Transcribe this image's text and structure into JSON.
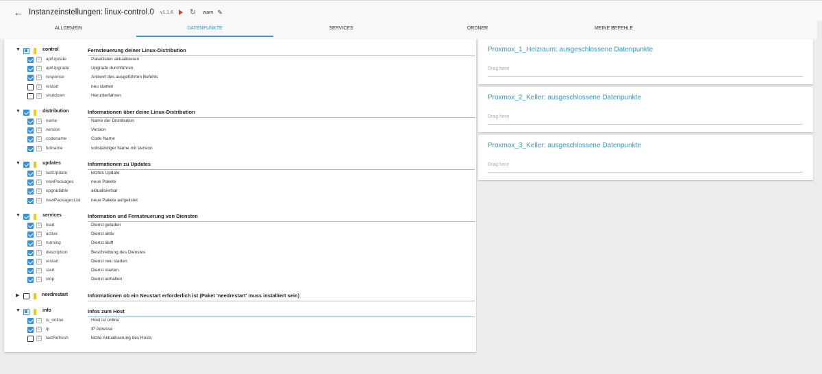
{
  "header": {
    "title": "Instanzeinstellungen: linux-control.0",
    "version": "v1.1.6",
    "loglevel": "warn",
    "accent_color": "#3399cc",
    "run_color": "#e53935"
  },
  "tabs": [
    {
      "label": "ALLGEMEIN",
      "active": false
    },
    {
      "label": "DATENPUNKTE",
      "active": true
    },
    {
      "label": "SERVICES",
      "active": false
    },
    {
      "label": "ORDNER",
      "active": false
    },
    {
      "label": "MEINE BEFEHLE",
      "active": false
    }
  ],
  "tree": [
    {
      "folder": "control",
      "desc": "Fernsteuerung deiner Linux-Distribution",
      "state": "partial",
      "expanded": true,
      "items": [
        {
          "name": "aptUpdate",
          "desc": "Paketlisten aktualisieren",
          "checked": true
        },
        {
          "name": "aptUpgrade",
          "desc": "Upgrade durchführen",
          "checked": true
        },
        {
          "name": "response",
          "desc": "Antwort des ausgeführten Befehls",
          "checked": true
        },
        {
          "name": "restart",
          "desc": "neu starten",
          "checked": false
        },
        {
          "name": "shutdown",
          "desc": "Herunterfahren",
          "checked": false
        }
      ]
    },
    {
      "folder": "distribution",
      "desc": "Informationen über deine Linux-Distribution",
      "state": "checked",
      "expanded": true,
      "items": [
        {
          "name": "name",
          "desc": "Name der Distribution",
          "checked": true
        },
        {
          "name": "version",
          "desc": "Version",
          "checked": true
        },
        {
          "name": "codename",
          "desc": "Code Name",
          "checked": true
        },
        {
          "name": "fullname",
          "desc": "vollständiger Name mit Version",
          "checked": true
        }
      ]
    },
    {
      "folder": "updates",
      "desc": "Informationen zu Updates",
      "state": "checked",
      "expanded": true,
      "items": [
        {
          "name": "lastUpdate",
          "desc": "letztes Update",
          "checked": true
        },
        {
          "name": "newPackages",
          "desc": "neue Pakete",
          "checked": true
        },
        {
          "name": "upgradable",
          "desc": "aktualisierbar",
          "checked": true
        },
        {
          "name": "newPackagesList",
          "desc": "neue Pakete aufgelistet",
          "checked": true
        }
      ]
    },
    {
      "folder": "services",
      "desc": "Information und Fernsteuerung von Diensten",
      "state": "checked",
      "expanded": true,
      "items": [
        {
          "name": "load",
          "desc": "Dienst geladen",
          "checked": true
        },
        {
          "name": "active",
          "desc": "Dienst aktiv",
          "checked": true
        },
        {
          "name": "running",
          "desc": "Dienst läuft",
          "checked": true
        },
        {
          "name": "description",
          "desc": "Beschreibung des Dienstes",
          "checked": true
        },
        {
          "name": "restart",
          "desc": "Dienst neu starten",
          "checked": true
        },
        {
          "name": "start",
          "desc": "Dienst starten",
          "checked": true
        },
        {
          "name": "stop",
          "desc": "Dienst anhalten",
          "checked": true
        }
      ]
    },
    {
      "folder": "needrestart",
      "desc": "Informationen ob ein Neustart erforderlich ist (Paket 'needrestart' muss installiert sein)",
      "state": "unchecked",
      "expanded": false,
      "items": []
    },
    {
      "folder": "info",
      "desc": "Infos zum Host",
      "state": "partial",
      "expanded": true,
      "items": [
        {
          "name": "is_online",
          "desc": "Host ist online",
          "checked": true
        },
        {
          "name": "ip",
          "desc": "IP Adresse",
          "checked": true
        },
        {
          "name": "lastRefresh",
          "desc": "letzte Aktualisierung des Hosts",
          "checked": false
        }
      ]
    }
  ],
  "hosts": [
    {
      "title": "Proxmox_1_Heizraum: ausgeschlossene Datenpunkte",
      "drag": "Drag here"
    },
    {
      "title": "Proxmox_2_Keller: ausgeschlossene Datenpunkte",
      "drag": "Drag here"
    },
    {
      "title": "Proxmox_3_Keller: ausgeschlossene Datenpunkte",
      "drag": "Drag here"
    }
  ]
}
